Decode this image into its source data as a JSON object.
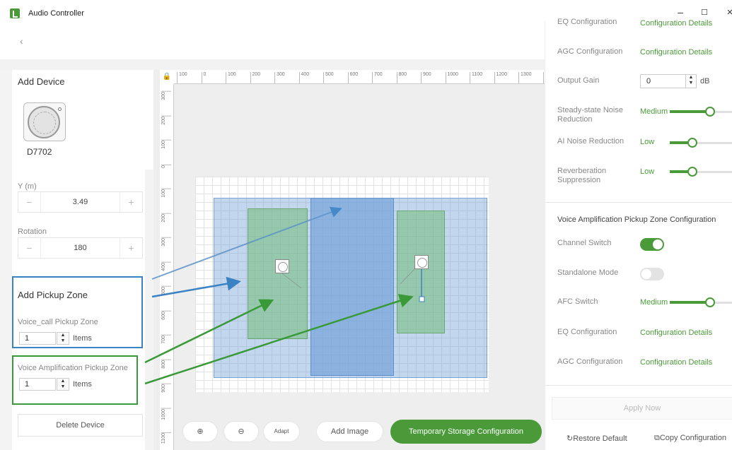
{
  "window": {
    "title": "Audio Controller",
    "minimize": "–",
    "maximize": "☐",
    "close": "✕"
  },
  "nav": {
    "back": "‹"
  },
  "left": {
    "add_device_title": "Add Device",
    "device_name": "D7702",
    "y_label": "Y (m)",
    "y_value": "3.49",
    "rotation_label": "Rotation",
    "rotation_value": "180",
    "minus": "−",
    "plus": "+",
    "pickup_title": "Add Pickup Zone",
    "voice_call_label": "Voice_call Pickup Zone",
    "voice_call_count": "1",
    "items_label": "Items",
    "voice_amp_label": "Voice Amplification Pickup Zone",
    "voice_amp_count": "1",
    "delete_label": "Delete Device"
  },
  "canvas": {
    "ruler_top": [
      "100",
      "0",
      "100",
      "200",
      "300",
      "400",
      "500",
      "600",
      "700",
      "800",
      "900",
      "1000",
      "1100",
      "1200",
      "1300",
      "1"
    ],
    "ruler_left": [
      "300",
      "200",
      "100",
      "0",
      "100",
      "200",
      "300",
      "400",
      "500",
      "600",
      "700",
      "800",
      "900",
      "1000",
      "1100"
    ],
    "zoom_in": "⊕",
    "zoom_out": "⊖",
    "adapt": "Adapt",
    "add_image": "Add Image",
    "temp_storage": "Temporary Storage Configuration"
  },
  "right": {
    "eq_top_label": "EQ Configuration",
    "eq_top_link": "Configuration Details",
    "agc_label": "AGC Configuration",
    "agc_link": "Configuration Details",
    "output_gain_label": "Output Gain",
    "output_gain_value": "0",
    "output_gain_unit": "dB",
    "steady_noise_label": "Steady-state Noise Reduction",
    "steady_noise_level": "Medium",
    "steady_noise_fraction": 0.66,
    "ai_noise_label": "AI Noise Reduction",
    "ai_noise_level": "Low",
    "ai_noise_fraction": 0.33,
    "reverb_label": "Reverberation Suppression",
    "reverb_level": "Low",
    "reverb_fraction": 0.33,
    "va_section_title": "Voice Amplification Pickup Zone Configuration",
    "channel_switch_label": "Channel Switch",
    "channel_switch_on": true,
    "standalone_label": "Standalone Mode",
    "standalone_on": false,
    "afc_label": "AFC Switch",
    "afc_level": "Medium",
    "afc_fraction": 0.66,
    "eq_label": "EQ Configuration",
    "eq_link": "Configuration Details",
    "agc2_label": "AGC Configuration",
    "agc2_link": "Configuration Details",
    "apply_label": "Apply Now",
    "restore_label": "Restore Default",
    "copy_label": "Copy Configuration"
  },
  "colors": {
    "accent_green": "#4a9a3a",
    "accent_blue": "#3a82c4",
    "zone_blue": "#8fb4dd",
    "zone_green": "#8fcf9a"
  }
}
